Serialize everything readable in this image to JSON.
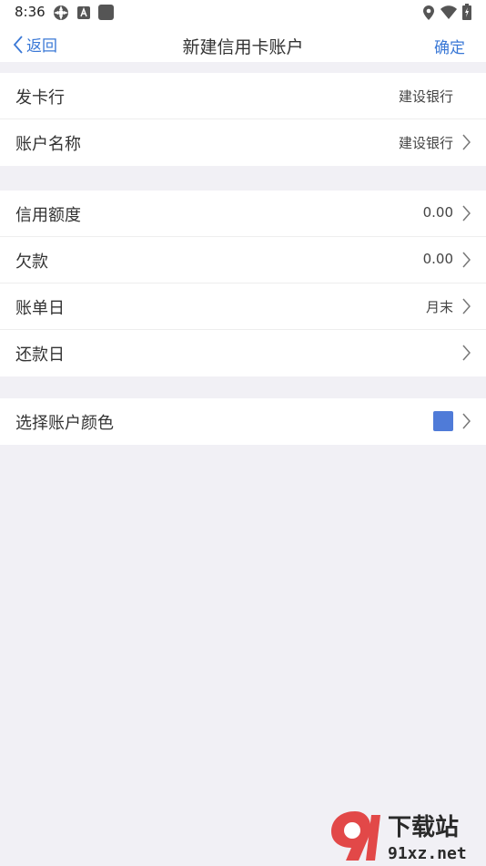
{
  "status_bar": {
    "time": "8:36",
    "icons": [
      "gear-icon",
      "app-a-icon",
      "square-app-icon",
      "location-icon",
      "wifi-icon",
      "battery-icon"
    ]
  },
  "nav": {
    "back_label": "返回",
    "title": "新建信用卡账户",
    "confirm_label": "确定"
  },
  "groups": {
    "bank": {
      "issuer_label": "发卡行",
      "issuer_value": "建设银行",
      "account_name_label": "账户名称",
      "account_name_value": "建设银行"
    },
    "credit": {
      "limit_label": "信用额度",
      "limit_value": "0.00",
      "debt_label": "欠款",
      "debt_value": "0.00",
      "bill_day_label": "账单日",
      "bill_day_value": "月末",
      "repay_day_label": "还款日",
      "repay_day_value": ""
    },
    "color": {
      "label": "选择账户颜色",
      "swatch_color": "#4f7bd8"
    }
  },
  "colors": {
    "accent": "#3a78d6",
    "background": "#f1f0f5"
  },
  "watermark": {
    "brand": "下载站",
    "domain": "91xz.net"
  }
}
